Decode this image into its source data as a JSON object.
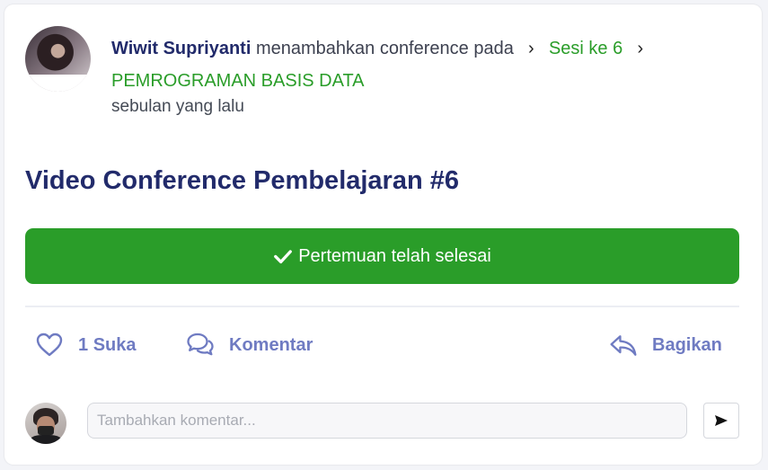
{
  "post": {
    "author": "Wiwit Supriyanti",
    "action_text": "menambahkan conference pada",
    "breadcrumb": [
      "Sesi ke 6",
      "PEMROGRAMAN BASIS DATA"
    ],
    "time_ago": "sebulan yang lalu",
    "title": "Video Conference Pembelajaran #6"
  },
  "status": {
    "label": "Pertemuan telah selesai",
    "icon": "check-icon",
    "color": "#2a9d29"
  },
  "actions": {
    "like_count": "1",
    "like_label": "Suka",
    "comment_label": "Komentar",
    "share_label": "Bagikan",
    "accent": "#6f7bc2"
  },
  "comment_box": {
    "placeholder": "Tambahkan komentar...",
    "value": ""
  },
  "colors": {
    "title": "#222b6b",
    "link": "#2a9d29"
  }
}
